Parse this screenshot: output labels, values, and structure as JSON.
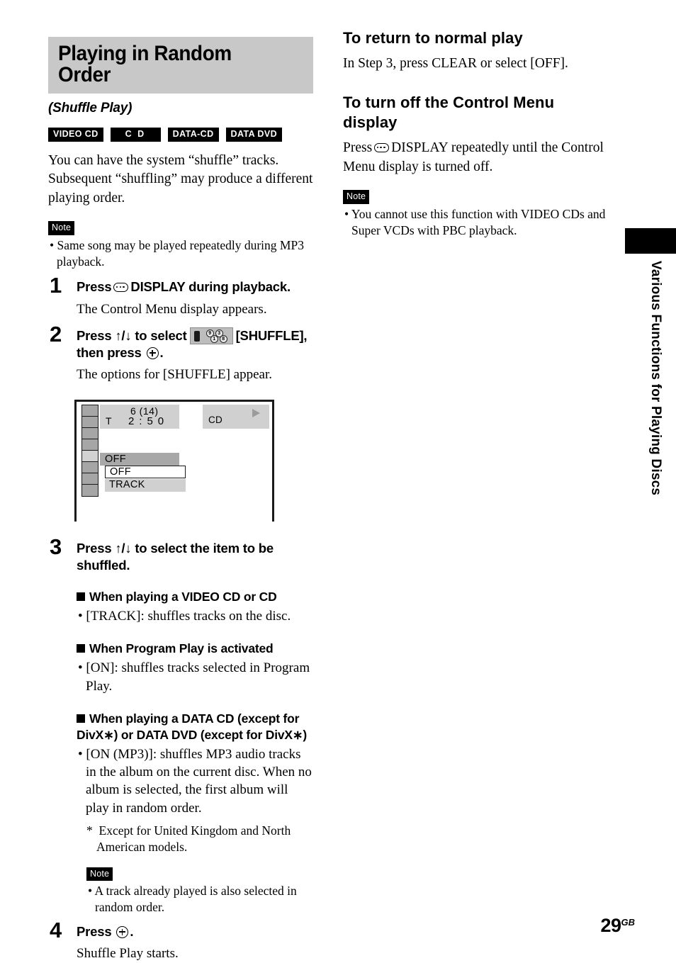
{
  "section": {
    "title": "Playing in Random Order",
    "subtitle": "(Shuffle Play)",
    "badges": [
      "VIDEO CD",
      "C D",
      "DATA-CD",
      "DATA DVD"
    ],
    "intro": "You can have the system “shuffle” tracks. Subsequent “shuffling” may produce a different playing order."
  },
  "note_top": {
    "label": "Note",
    "items": [
      "• Same song may be played repeatedly during MP3 playback."
    ]
  },
  "steps": {
    "one": {
      "num": "1",
      "head_a": "Press",
      "head_b": "DISPLAY during playback.",
      "sub": "The Control Menu display appears."
    },
    "two": {
      "num": "2",
      "head_a": "Press ↑/↓ to select",
      "head_b": "[SHUFFLE],",
      "head_c": "then press",
      "head_d": ".",
      "sub": "The options for [SHUFFLE] appear.",
      "icon_balls": [
        "9",
        "3",
        "1",
        "8"
      ]
    },
    "three": {
      "num": "3",
      "head": "Press ↑/↓ to select the item to be shuffled.",
      "groups": [
        {
          "heading": "When playing a VIDEO CD or CD",
          "bullets": [
            "• [TRACK]: shuffles tracks on the disc."
          ]
        },
        {
          "heading": "When Program Play is activated",
          "bullets": [
            "• [ON]: shuffles tracks selected in Program Play."
          ]
        },
        {
          "heading": "When playing a DATA CD (except for DivX∗) or DATA DVD (except for DivX∗)",
          "bullets": [
            "• [ON (MP3)]: shuffles MP3 audio tracks in the album on the current disc. When no album is selected, the first album will play in random order."
          ]
        }
      ],
      "footnote": "* Except for United Kingdom and North American models.",
      "note": {
        "label": "Note",
        "items": [
          "• A track already played is also selected in random order."
        ]
      }
    },
    "four": {
      "num": "4",
      "head_a": "Press",
      "head_b": ".",
      "sub": "Shuffle Play starts."
    }
  },
  "osd": {
    "track_number": "6 (14)",
    "track_prefix": "T",
    "track_time": "2 : 5 0",
    "disc_label": "CD",
    "current_value": "OFF",
    "options": [
      {
        "label": "OFF",
        "selected": true
      },
      {
        "label": "TRACK",
        "selected": false
      }
    ],
    "rail_cells": 8,
    "rail_active_index": 4,
    "colors": {
      "panel_gray": "#d0d0d0",
      "highlight_gray": "#a8a8a8",
      "rail_gray": "#a6a6a6",
      "rail_active": "#d2d2d2",
      "border": "#1a1a1a"
    }
  },
  "right_column": {
    "heading1": "To return to normal play",
    "body1": "In Step 3, press CLEAR or select [OFF].",
    "heading2": "To turn off the Control Menu display",
    "body2_a": "Press",
    "body2_b": "DISPLAY repeatedly until the Control Menu display is turned off.",
    "note": {
      "label": "Note",
      "items": [
        "• You cannot use this function with VIDEO CDs and Super VCDs with PBC playback."
      ]
    }
  },
  "side_tab": {
    "text": "Various Functions for Playing Discs"
  },
  "page_number": {
    "value": "29",
    "suffix": "GB"
  }
}
